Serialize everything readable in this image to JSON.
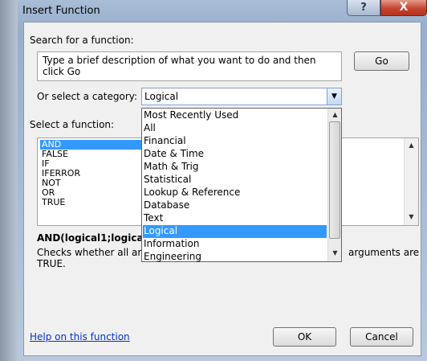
{
  "window": {
    "title": "Insert Function",
    "help_glyph": "?",
    "close_glyph": "X"
  },
  "search": {
    "label": "Search for a function:",
    "value": "Type a brief description of what you want to do and then click Go",
    "go_label": "Go"
  },
  "category": {
    "label": "Or select a category:",
    "selected": "Logical",
    "options": [
      "Most Recently Used",
      "All",
      "Financial",
      "Date & Time",
      "Math & Trig",
      "Statistical",
      "Lookup & Reference",
      "Database",
      "Text",
      "Logical",
      "Information",
      "Engineering"
    ],
    "selected_index": 9
  },
  "functions": {
    "label": "Select a function:",
    "items": [
      "AND",
      "FALSE",
      "IF",
      "IFERROR",
      "NOT",
      "OR",
      "TRUE"
    ],
    "selected_index": 0
  },
  "syntax": "AND(logical1;logica",
  "description_left": "Checks whether all arg",
  "description_right": "arguments are",
  "description_line2": "TRUE.",
  "footer": {
    "help_link": "Help on this function",
    "ok_label": "OK",
    "cancel_label": "Cancel"
  },
  "colors": {
    "selection": "#3399ff",
    "link": "#0033cc",
    "close": "#c5442f"
  }
}
